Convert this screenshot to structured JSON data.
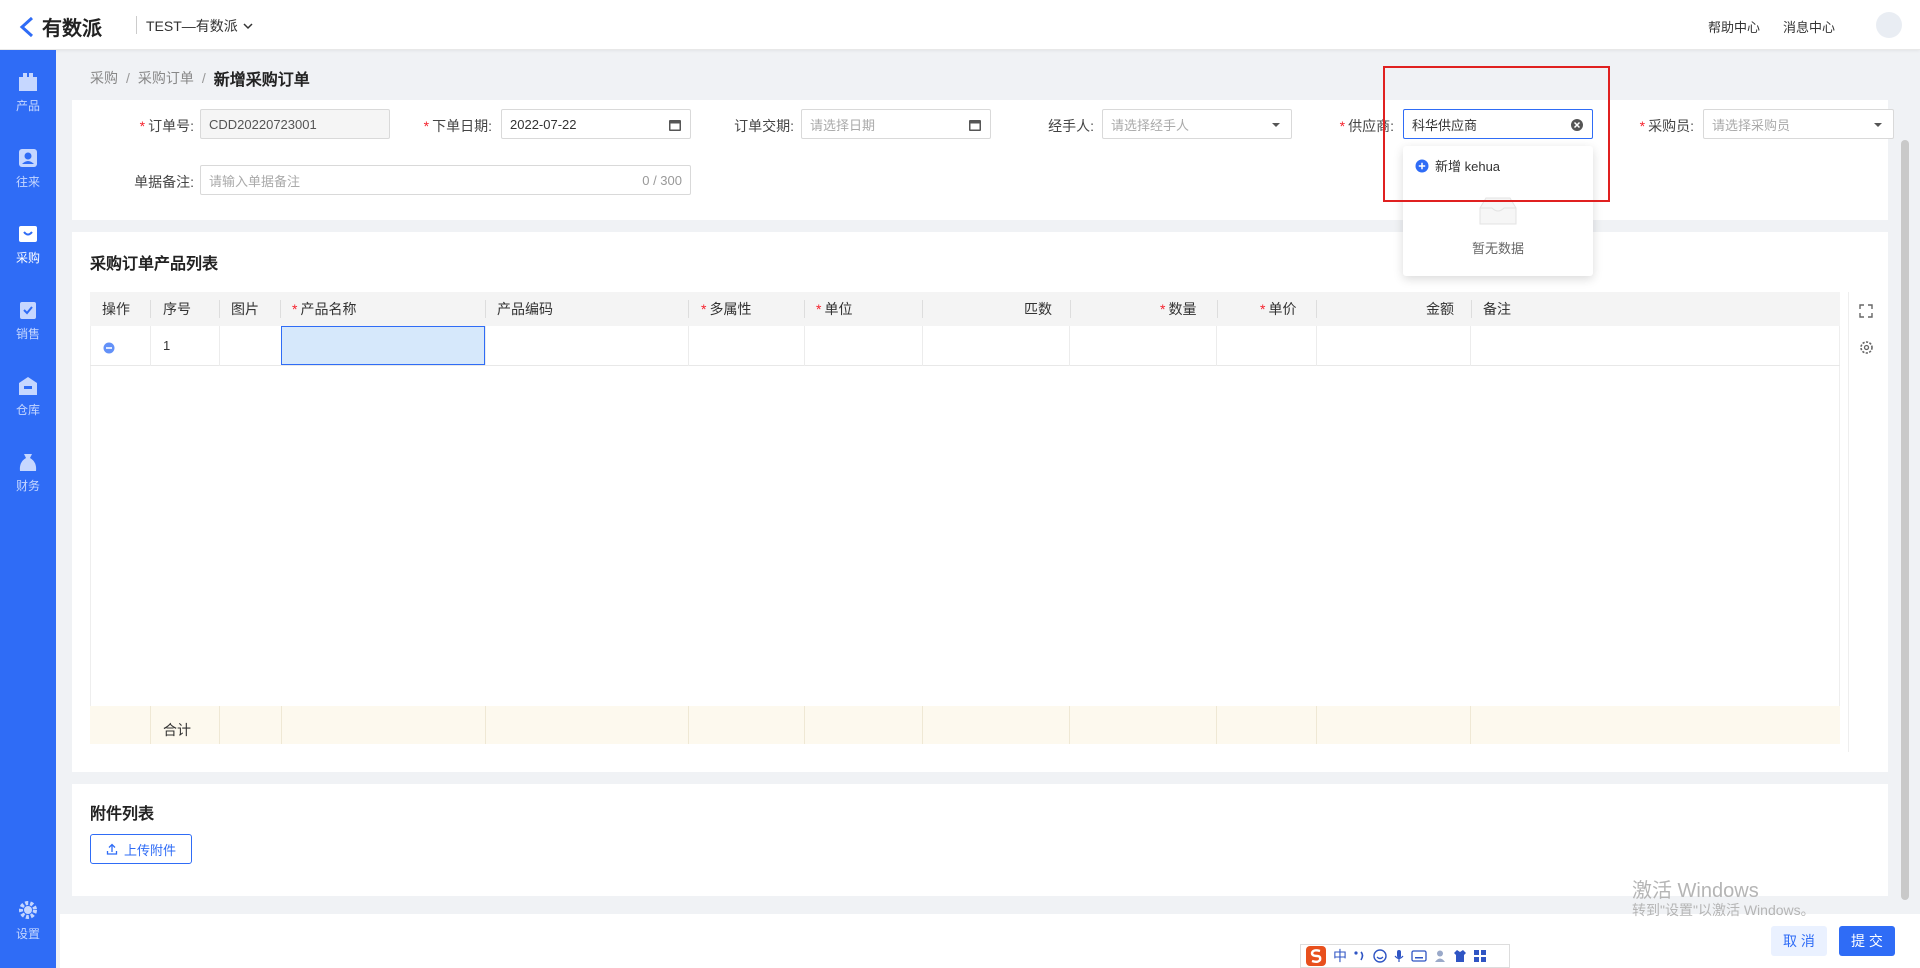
{
  "app": {
    "brand": "有数派",
    "org": "TEST—有数派",
    "help": "帮助中心",
    "messages": "消息中心"
  },
  "colors": {
    "primary": "#2f6cf6",
    "required": "#f5222d",
    "highlight": "#e02020"
  },
  "sidebar": {
    "items": [
      {
        "label": "产品",
        "icon": "box-icon"
      },
      {
        "label": "往来",
        "icon": "contacts-icon"
      },
      {
        "label": "采购",
        "icon": "cart-icon"
      },
      {
        "label": "销售",
        "icon": "clipboard-check-icon"
      },
      {
        "label": "仓库",
        "icon": "warehouse-icon"
      },
      {
        "label": "财务",
        "icon": "money-bag-icon"
      },
      {
        "label": "设置",
        "icon": "gear-icon"
      }
    ],
    "active": "采购"
  },
  "breadcrumb": {
    "level1": "采购",
    "level2": "采购订单",
    "current": "新增采购订单",
    "sep": "/"
  },
  "form": {
    "order_no": {
      "label": "订单号:",
      "value": "CDD20220723001"
    },
    "order_date": {
      "label": "下单日期:",
      "value": "2022-07-22"
    },
    "delivery_date": {
      "label": "订单交期:",
      "placeholder": "请选择日期"
    },
    "handler": {
      "label": "经手人:",
      "placeholder": "请选择经手人"
    },
    "supplier": {
      "label": "供应商:",
      "value": "科华供应商"
    },
    "buyer": {
      "label": "采购员:",
      "placeholder": "请选择采购员"
    },
    "remark": {
      "label": "单据备注:",
      "placeholder": "请输入单据备注",
      "counter": "0 / 300"
    }
  },
  "supplier_dropdown": {
    "add_label": "新增 kehua",
    "empty_text": "暂无数据"
  },
  "product_section": {
    "title": "采购订单产品列表",
    "columns": [
      {
        "label": "操作",
        "required": false
      },
      {
        "label": "序号",
        "required": false
      },
      {
        "label": "图片",
        "required": false
      },
      {
        "label": "产品名称",
        "required": true
      },
      {
        "label": "产品编码",
        "required": false
      },
      {
        "label": "多属性",
        "required": true
      },
      {
        "label": "单位",
        "required": true
      },
      {
        "label": "匹数",
        "required": false
      },
      {
        "label": "数量",
        "required": true
      },
      {
        "label": "单价",
        "required": true
      },
      {
        "label": "金额",
        "required": false
      },
      {
        "label": "备注",
        "required": false
      }
    ],
    "row_index": "1",
    "footer_label": "合计"
  },
  "attachments": {
    "title": "附件列表",
    "upload_label": "上传附件"
  },
  "actions": {
    "cancel": "取 消",
    "submit": "提 交"
  },
  "watermark": {
    "line1": "激活 Windows",
    "line2": "转到\"设置\"以激活 Windows。"
  },
  "ime": {
    "mode": "中"
  }
}
